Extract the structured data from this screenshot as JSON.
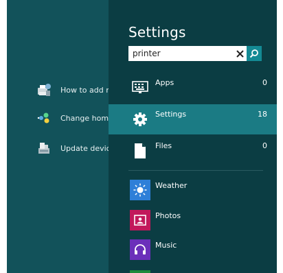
{
  "search_results": [
    {
      "label": "How to add n",
      "icon": "devices-printers-icon"
    },
    {
      "label": "Change home",
      "icon": "homegroup-icon"
    },
    {
      "label": "Update device",
      "icon": "device-manager-icon"
    }
  ],
  "pane": {
    "title": "Settings",
    "search": {
      "value": "printer",
      "placeholder": ""
    },
    "categories": [
      {
        "label": "Apps",
        "count": "0",
        "icon": "apps-keyboard-icon",
        "selected": false
      },
      {
        "label": "Settings",
        "count": "18",
        "icon": "gear-icon",
        "selected": true
      },
      {
        "label": "Files",
        "count": "0",
        "icon": "file-icon",
        "selected": false
      }
    ],
    "apps": [
      {
        "label": "Weather",
        "icon": "sun-icon",
        "color": "#2e7fd8"
      },
      {
        "label": "Photos",
        "icon": "photo-icon",
        "color": "#c2185b"
      },
      {
        "label": "Music",
        "icon": "headphones-icon",
        "color": "#6b2fba"
      }
    ]
  },
  "colors": {
    "background": "#12525a",
    "pane": "#0b3d43",
    "selected": "#1b7b84",
    "accent": "#148a94"
  }
}
